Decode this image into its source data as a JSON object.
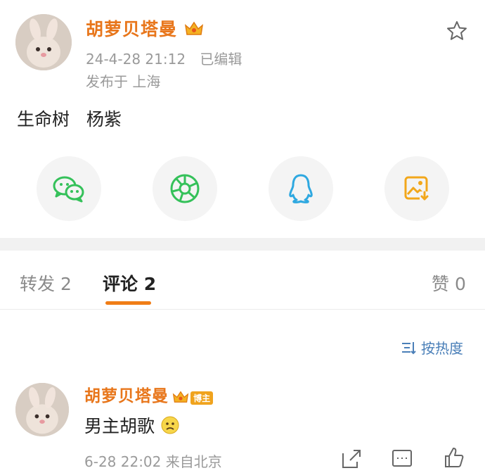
{
  "post": {
    "author": "胡萝贝塔曼",
    "timestamp": "24-4-28 21:12",
    "edited": "已编辑",
    "location": "发布于 上海",
    "text": "生命树   杨紫"
  },
  "share_buttons": [
    {
      "icon": "wechat-icon",
      "color": "#35c15a"
    },
    {
      "icon": "moments-icon",
      "color": "#35c15a"
    },
    {
      "icon": "qq-icon",
      "color": "#2ea8e0"
    },
    {
      "icon": "save-image-icon",
      "color": "#f2a71b"
    }
  ],
  "tabs": {
    "repost": "转发 2",
    "comments": "评论 2",
    "likes": "赞 0"
  },
  "sort_label": "按热度",
  "comment": {
    "author": "胡萝贝塔曼",
    "badge": "博主",
    "text": "男主胡歌",
    "timestamp": "6-28 22:02 来自北京"
  },
  "colors": {
    "accent": "#f07d16",
    "name": "#e8761b",
    "link": "#4a7fb8"
  }
}
